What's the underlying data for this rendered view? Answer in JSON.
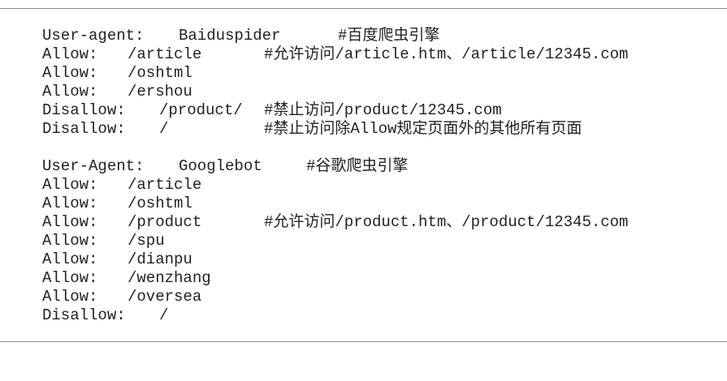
{
  "block1": {
    "useragent_key": "User-agent:",
    "useragent_val": "Baiduspider",
    "useragent_comment": "#百度爬虫引擎",
    "lines": [
      {
        "key": "Allow:",
        "val": "/article",
        "comment": "#允许访问/article.htm、/article/12345.com"
      },
      {
        "key": "Allow:",
        "val": "/oshtml",
        "comment": ""
      },
      {
        "key": "Allow:",
        "val": "/ershou",
        "comment": ""
      },
      {
        "key": "Disallow:",
        "val": "/product/",
        "comment": "#禁止访问/product/12345.com"
      },
      {
        "key": "Disallow:",
        "val": "/",
        "comment": "#禁止访问除Allow规定页面外的其他所有页面"
      }
    ]
  },
  "block2": {
    "useragent_key": "User-Agent:",
    "useragent_val": "Googlebot",
    "useragent_comment": "#谷歌爬虫引擎",
    "lines": [
      {
        "key": "Allow:",
        "val": "/article",
        "comment": ""
      },
      {
        "key": "Allow:",
        "val": "/oshtml",
        "comment": ""
      },
      {
        "key": "Allow:",
        "val": "/product",
        "comment": "#允许访问/product.htm、/product/12345.com"
      },
      {
        "key": "Allow:",
        "val": "/spu",
        "comment": ""
      },
      {
        "key": "Allow:",
        "val": "/dianpu",
        "comment": ""
      },
      {
        "key": "Allow:",
        "val": "/wenzhang",
        "comment": ""
      },
      {
        "key": "Allow:",
        "val": "/oversea",
        "comment": ""
      },
      {
        "key": "Disallow:",
        "val": "/",
        "comment": ""
      }
    ]
  }
}
